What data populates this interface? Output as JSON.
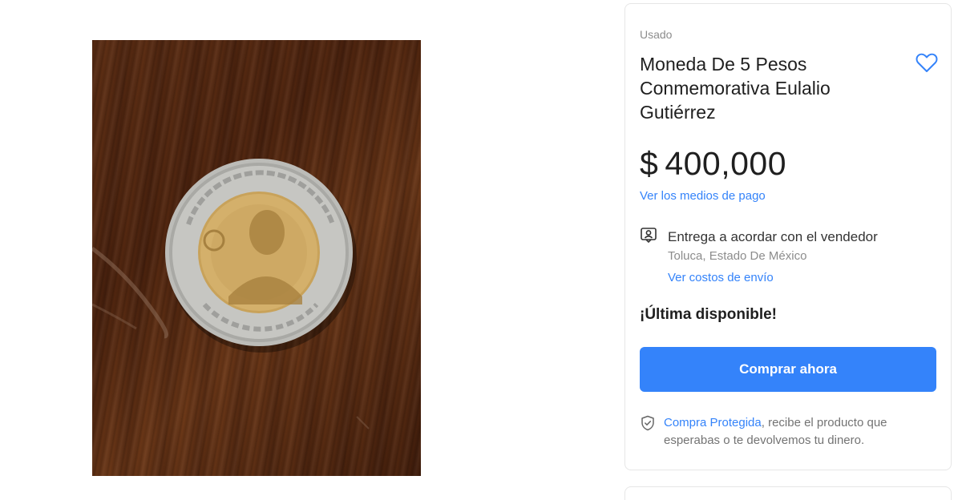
{
  "product": {
    "condition": "Usado",
    "title": "Moneda De 5 Pesos Conmemorativa Eulalio Gutiérrez",
    "price_currency": "$",
    "price_amount": "400,000",
    "payment_methods_link": "Ver los medios de pago",
    "delivery": {
      "title": "Entrega a acordar con el vendedor",
      "location": "Toluca, Estado De México",
      "costs_link": "Ver costos de envío"
    },
    "stock_message": "¡Última disponible!",
    "buy_button_label": "Comprar ahora",
    "protection": {
      "link": "Compra Protegida",
      "text": ", recibe el producto que esperabas o te devolvemos tu dinero."
    }
  },
  "colors": {
    "accent": "#3483fa",
    "text_primary": "#1f1f1f",
    "text_secondary": "#8c8c8c"
  },
  "icons": {
    "favorite": "heart-outline-icon",
    "delivery": "person-in-box-icon",
    "protection": "shield-check-icon"
  }
}
